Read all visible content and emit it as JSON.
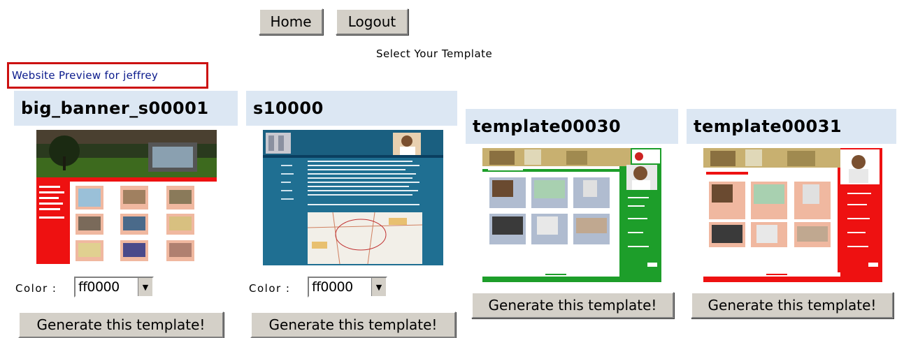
{
  "nav": {
    "home_label": "Home",
    "logout_label": "Logout"
  },
  "page": {
    "select_title": "Select Your Template",
    "preview_link": "Website Preview for jeffrey"
  },
  "templates": [
    {
      "name": "big_banner_s00001",
      "color_label": "Color :",
      "color_value": "ff0000",
      "generate_label": "Generate this template!",
      "accent": "#ee1111"
    },
    {
      "name": "s10000",
      "color_label": "Color :",
      "color_value": "ff0000",
      "generate_label": "Generate this template!",
      "accent": "#1f6f92"
    },
    {
      "name": "template00030",
      "generate_label": "Generate this template!",
      "accent": "#1d9e2a"
    },
    {
      "name": "template00031",
      "generate_label": "Generate this template!",
      "accent": "#ee1111"
    }
  ],
  "colors": {
    "header_bg": "#dce7f3",
    "link": "#0a1a8c",
    "link_border": "#cc1111",
    "button_face": "#d4d0c8"
  }
}
